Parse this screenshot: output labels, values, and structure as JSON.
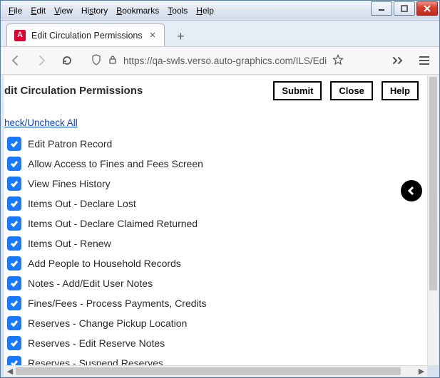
{
  "menubar": [
    "File",
    "Edit",
    "View",
    "History",
    "Bookmarks",
    "Tools",
    "Help"
  ],
  "tab": {
    "title": "Edit Circulation Permissions"
  },
  "url": "https://qa-swls.verso.auto-graphics.com/ILS/Edi",
  "page": {
    "title": "dit Circulation Permissions",
    "buttons": {
      "submit": "Submit",
      "close": "Close",
      "help": "Help"
    },
    "toggle_link": "heck/Uncheck All",
    "permissions": [
      "Edit Patron Record",
      "Allow Access to Fines and Fees Screen",
      "View Fines History",
      "Items Out - Declare Lost",
      "Items Out - Declare Claimed Returned",
      "Items Out - Renew",
      "Add People to Household Records",
      "Notes - Add/Edit User Notes",
      "Fines/Fees - Process Payments, Credits",
      "Reserves - Change Pickup Location",
      "Reserves - Edit Reserve Notes",
      "Reserves - Suspend Reserves"
    ]
  }
}
